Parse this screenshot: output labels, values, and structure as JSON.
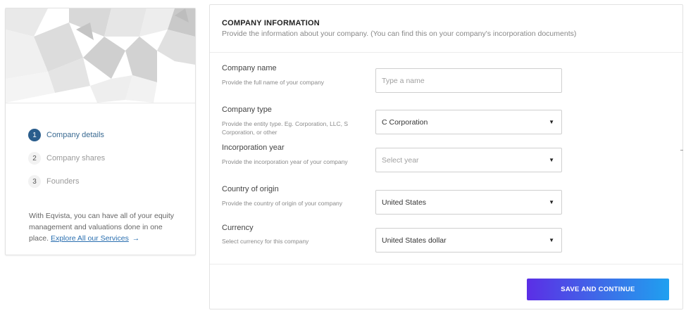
{
  "sidebar": {
    "steps": [
      {
        "number": "1",
        "label": "Company details",
        "active": true
      },
      {
        "number": "2",
        "label": "Company shares",
        "active": false
      },
      {
        "number": "3",
        "label": "Founders",
        "active": false
      }
    ],
    "note_text": "With Eqvista, you can have all of your equity management and valuations done in one place.",
    "note_link": "Explore All our Services",
    "note_arrow": "→"
  },
  "form": {
    "title": "COMPANY INFORMATION",
    "subtitle": "Provide the information about your company. (You can find this on your company's incorporation documents)",
    "company_name": {
      "label": "Company name",
      "help": "Provide the full name of your company",
      "value": "",
      "placeholder": "Type a name"
    },
    "company_type": {
      "label": "Company type",
      "help": "Provide the entity type. Eg. Corporation, LLC, S Corporation, or other",
      "value": "C Corporation"
    },
    "incorporation_year": {
      "label": "Incorporation year",
      "help": "Provide the incorporation year of your company",
      "value": "Select year"
    },
    "country": {
      "label": "Country of origin",
      "help": "Provide the country of origin of your company",
      "value": "United States"
    },
    "currency": {
      "label": "Currency",
      "help": "Select currency for this company",
      "value": "United States dollar"
    },
    "caret": "▼",
    "save_label": "SAVE AND CONTINUE"
  },
  "colors": {
    "active_step": "#2a5d8c",
    "link": "#2a6fb0",
    "button_gradient_start": "#5b2ee6",
    "button_gradient_end": "#1fa0f0"
  }
}
